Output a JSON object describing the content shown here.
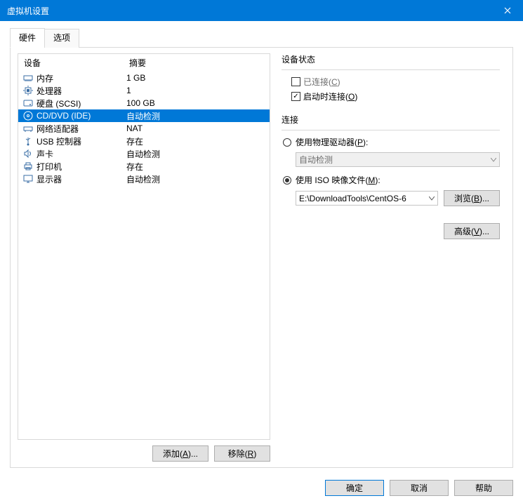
{
  "title": "虚拟机设置",
  "tabs": {
    "hardware": "硬件",
    "options": "选项"
  },
  "headers": {
    "device": "设备",
    "summary": "摘要"
  },
  "devices": [
    {
      "name": "内存",
      "summary": "1 GB",
      "icon": "memory"
    },
    {
      "name": "处理器",
      "summary": "1",
      "icon": "cpu"
    },
    {
      "name": "硬盘 (SCSI)",
      "summary": "100 GB",
      "icon": "disk"
    },
    {
      "name": "CD/DVD (IDE)",
      "summary": "自动检测",
      "icon": "cd",
      "selected": true
    },
    {
      "name": "网络适配器",
      "summary": "NAT",
      "icon": "net"
    },
    {
      "name": "USB 控制器",
      "summary": "存在",
      "icon": "usb"
    },
    {
      "name": "声卡",
      "summary": "自动检测",
      "icon": "sound"
    },
    {
      "name": "打印机",
      "summary": "存在",
      "icon": "printer"
    },
    {
      "name": "显示器",
      "summary": "自动检测",
      "icon": "display"
    }
  ],
  "buttons": {
    "add": "添加(A)...",
    "remove": "移除(R)",
    "browse": "浏览(B)...",
    "advanced": "高级(V)...",
    "ok": "确定",
    "cancel": "取消",
    "help": "帮助"
  },
  "status": {
    "title": "设备状态",
    "connected": "已连接(C)",
    "connectOnStart": "启动时连接(O)"
  },
  "connection": {
    "title": "连接",
    "physical": "使用物理驱动器(P):",
    "physicalValue": "自动检测",
    "iso": "使用 ISO 映像文件(M):",
    "isoValue": "E:\\DownloadTools\\CentOS-6"
  }
}
